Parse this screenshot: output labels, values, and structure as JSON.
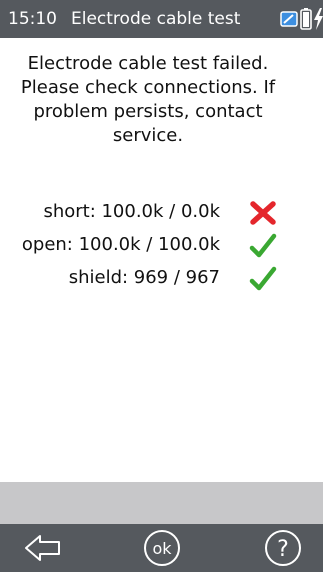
{
  "statusbar": {
    "time": "15:10",
    "title": "Electrode cable test"
  },
  "message": {
    "text": "Electrode cable test failed. Please check connections. If problem persists, contact service."
  },
  "results": [
    {
      "text": "short: 100.0k / 0.0k",
      "status": "fail",
      "icon": "cross-icon"
    },
    {
      "text": "open: 100.0k / 100.0k",
      "status": "pass",
      "icon": "check-icon"
    },
    {
      "text": "shield: 969 / 967",
      "status": "pass",
      "icon": "check-icon"
    }
  ],
  "navbar": {
    "back_icon": "back-arrow-icon",
    "ok_label": "ok",
    "help_label": "?"
  },
  "colors": {
    "statusbar_bg": "#55595e",
    "grey_bar": "#c7c7c9",
    "fail": "#e4262c",
    "pass": "#3aa832"
  }
}
